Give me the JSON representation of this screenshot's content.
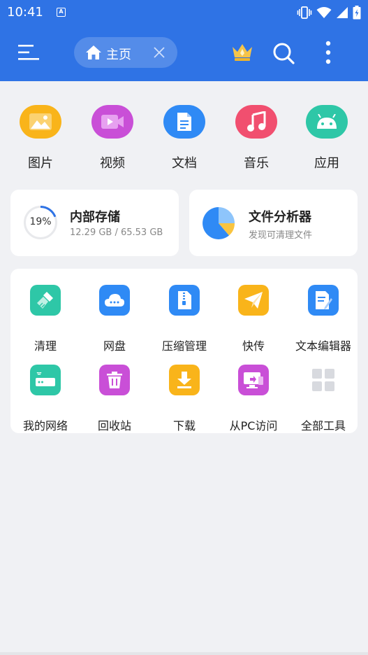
{
  "status_bar": {
    "time": "10:41",
    "notification_badge": "A",
    "icons": [
      "vibrate-icon",
      "wifi-icon",
      "signal-icon",
      "battery-charging-icon"
    ]
  },
  "toolbar": {
    "menu_icon": "menu-icon",
    "home_tab_label": "主页",
    "home_icon": "home-icon",
    "close_icon": "close-icon",
    "vip_icon": "crown-icon",
    "search_icon": "search-icon",
    "more_icon": "more-vertical-icon"
  },
  "categories": [
    {
      "label": "图片",
      "icon": "image-icon",
      "color": "#f9b41a"
    },
    {
      "label": "视频",
      "icon": "video-icon",
      "color": "#c94fd7"
    },
    {
      "label": "文档",
      "icon": "document-icon",
      "color": "#2f8af5"
    },
    {
      "label": "音乐",
      "icon": "music-icon",
      "color": "#f14f6f"
    },
    {
      "label": "应用",
      "icon": "android-icon",
      "color": "#2ec7a7"
    }
  ],
  "storage": {
    "title": "内部存储",
    "percent_label": "19%",
    "used_fraction": 0.19,
    "detail": "12.29 GB / 65.53 GB"
  },
  "analyzer": {
    "title": "文件分析器",
    "subtitle": "发现可清理文件"
  },
  "tools": [
    {
      "label": "清理",
      "icon": "broom-icon",
      "color": "#2ec7a7"
    },
    {
      "label": "网盘",
      "icon": "cloud-drive-icon",
      "color": "#2f8af5"
    },
    {
      "label": "压缩管理",
      "icon": "zip-file-icon",
      "color": "#2f8af5"
    },
    {
      "label": "快传",
      "icon": "send-icon",
      "color": "#f9b41a"
    },
    {
      "label": "文本编辑器",
      "icon": "text-edit-icon",
      "color": "#2f8af5"
    },
    {
      "label": "我的网络",
      "icon": "router-icon",
      "color": "#2ec7a7"
    },
    {
      "label": "回收站",
      "icon": "trash-icon",
      "color": "#c94fd7"
    },
    {
      "label": "下载",
      "icon": "download-icon",
      "color": "#f9b41a"
    },
    {
      "label": "从PC访问",
      "icon": "pc-access-icon",
      "color": "#c94fd7"
    },
    {
      "label": "全部工具",
      "icon": "grid-icon",
      "color": "#d8dadf"
    }
  ]
}
